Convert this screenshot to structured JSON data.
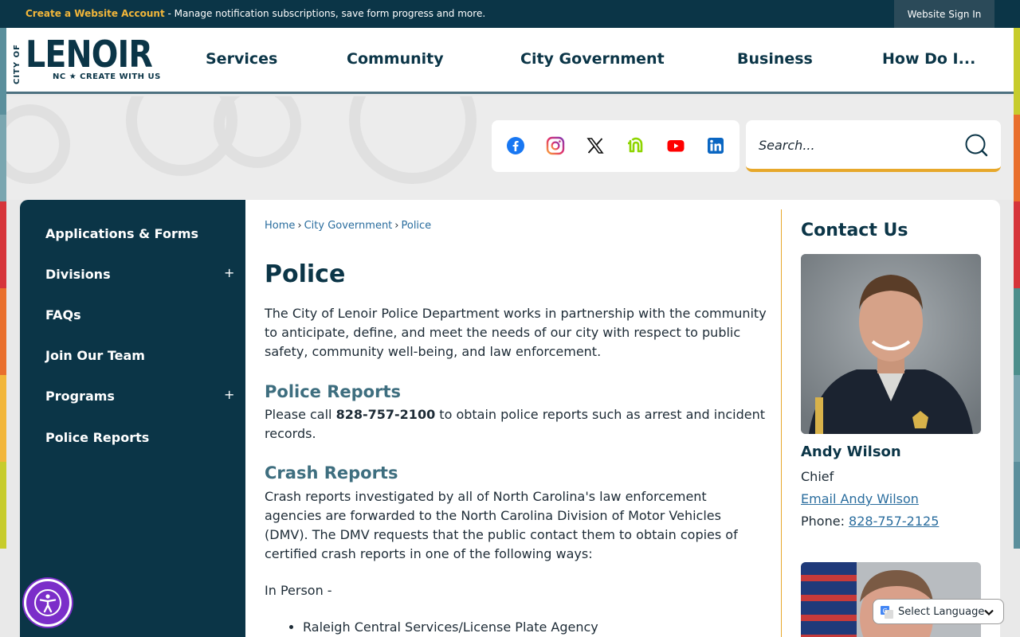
{
  "topbar": {
    "account_link": "Create a Website Account",
    "message": " - Manage notification subscriptions, save form progress and more.",
    "signin": "Website Sign In"
  },
  "logo": {
    "city_of": "CITY OF",
    "name": "LENOIR",
    "tagline": "NC ★ CREATE WITH US"
  },
  "nav": [
    "Services",
    "Community",
    "City Government",
    "Business",
    "How Do I..."
  ],
  "social": [
    "facebook-icon",
    "instagram-icon",
    "x-icon",
    "nextdoor-icon",
    "youtube-icon",
    "linkedin-icon"
  ],
  "search": {
    "placeholder": "Search..."
  },
  "sidebar": {
    "items": [
      {
        "label": "Applications & Forms",
        "expandable": false
      },
      {
        "label": "Divisions",
        "expandable": true
      },
      {
        "label": "FAQs",
        "expandable": false
      },
      {
        "label": "Join Our Team",
        "expandable": false
      },
      {
        "label": "Programs",
        "expandable": true
      },
      {
        "label": "Police Reports",
        "expandable": false
      }
    ],
    "expand_symbol": "+"
  },
  "breadcrumb": [
    "Home",
    "City Government",
    "Police"
  ],
  "breadcrumb_sep": "›",
  "page": {
    "title": "Police",
    "intro": "The City of Lenoir Police Department works in partnership with the community to anticipate, define, and meet the needs of our city with respect to public safety, community well-being, and law enforcement.",
    "reports_heading": "Police Reports",
    "reports_pre": "Please call ",
    "reports_phone": "828-757-2100",
    "reports_post": " to obtain police reports such as arrest and incident records.",
    "crash_heading": "Crash Reports",
    "crash_text": "Crash reports investigated by all of North Carolina's law enforcement agencies are forwarded to the North Carolina Division of Motor Vehicles (DMV). The DMV requests that the public contact them to obtain copies of certified crash reports in one of the following ways:",
    "in_person": "In Person -",
    "bullets": [
      "Raleigh Central Services/License Plate Agency"
    ]
  },
  "contact": {
    "title": "Contact Us",
    "name": "Andy Wilson",
    "role": "Chief",
    "email_label": "Email Andy Wilson",
    "phone_label": "Phone: ",
    "phone": "828-757-2125"
  },
  "language": {
    "label": "Select Language"
  },
  "colors": {
    "navy": "#0b3547",
    "gold": "#e7a82b",
    "link": "#2a6d9e",
    "heading_teal": "#3e6e7f"
  }
}
